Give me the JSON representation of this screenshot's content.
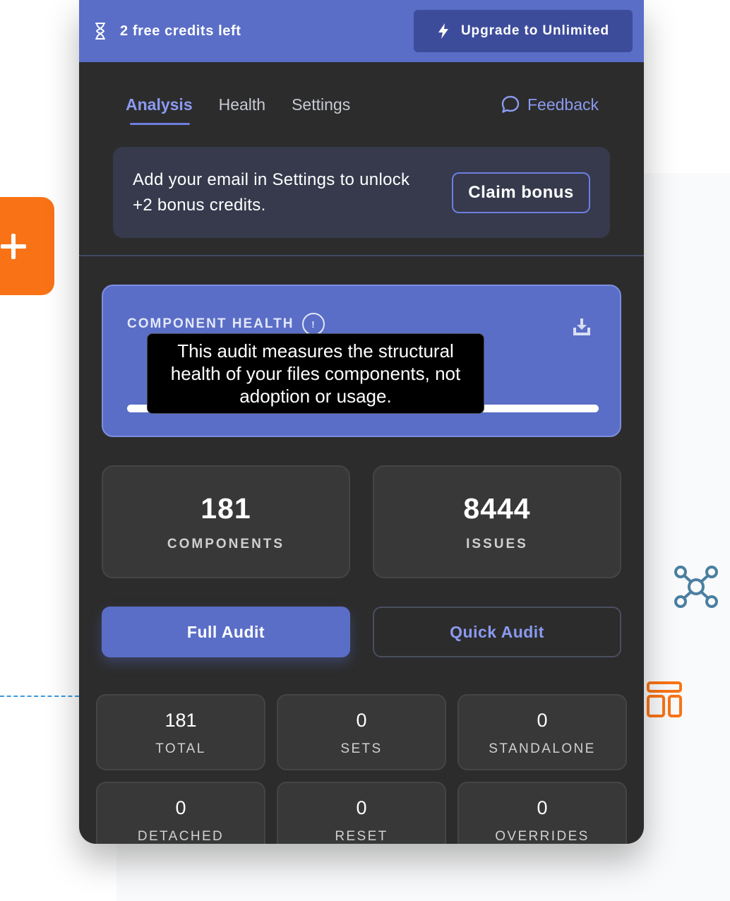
{
  "banner": {
    "credits_text": "2 free credits left",
    "upgrade_label": "Upgrade to Unlimited"
  },
  "tabs": [
    {
      "label": "Analysis",
      "active": true
    },
    {
      "label": "Health",
      "active": false
    },
    {
      "label": "Settings",
      "active": false
    }
  ],
  "feedback_label": "Feedback",
  "bonus": {
    "text": "Add your email in Settings to unlock +2 bonus credits.",
    "button_label": "Claim bonus"
  },
  "health": {
    "label": "COMPONENT HEALTH",
    "info_glyph": "!",
    "tooltip": "This audit measures the structural health of your files components, not adoption or usage."
  },
  "stats": [
    {
      "value": "181",
      "label": "COMPONENTS"
    },
    {
      "value": "8444",
      "label": "ISSUES"
    }
  ],
  "actions": {
    "full_audit": "Full Audit",
    "quick_audit": "Quick Audit"
  },
  "breakdown": [
    {
      "value": "181",
      "label": "TOTAL"
    },
    {
      "value": "0",
      "label": "SETS"
    },
    {
      "value": "0",
      "label": "STANDALONE"
    },
    {
      "value": "0",
      "label": "DETACHED"
    },
    {
      "value": "0",
      "label": "RESET"
    },
    {
      "value": "0",
      "label": "OVERRIDES"
    }
  ],
  "icons": {
    "hourglass": "hourglass-icon",
    "lightning": "lightning-icon",
    "chat": "chat-bubble-icon",
    "info": "info-icon",
    "download": "download-icon",
    "plus": "plus-icon",
    "network": "network-icon",
    "layout": "layout-icon"
  },
  "colors": {
    "accent": "#5a6ec7",
    "accent_text": "#8b9af0",
    "panel_bg": "#2c2c2c",
    "orange": "#f97316",
    "network_blue": "#4b7fa1"
  }
}
